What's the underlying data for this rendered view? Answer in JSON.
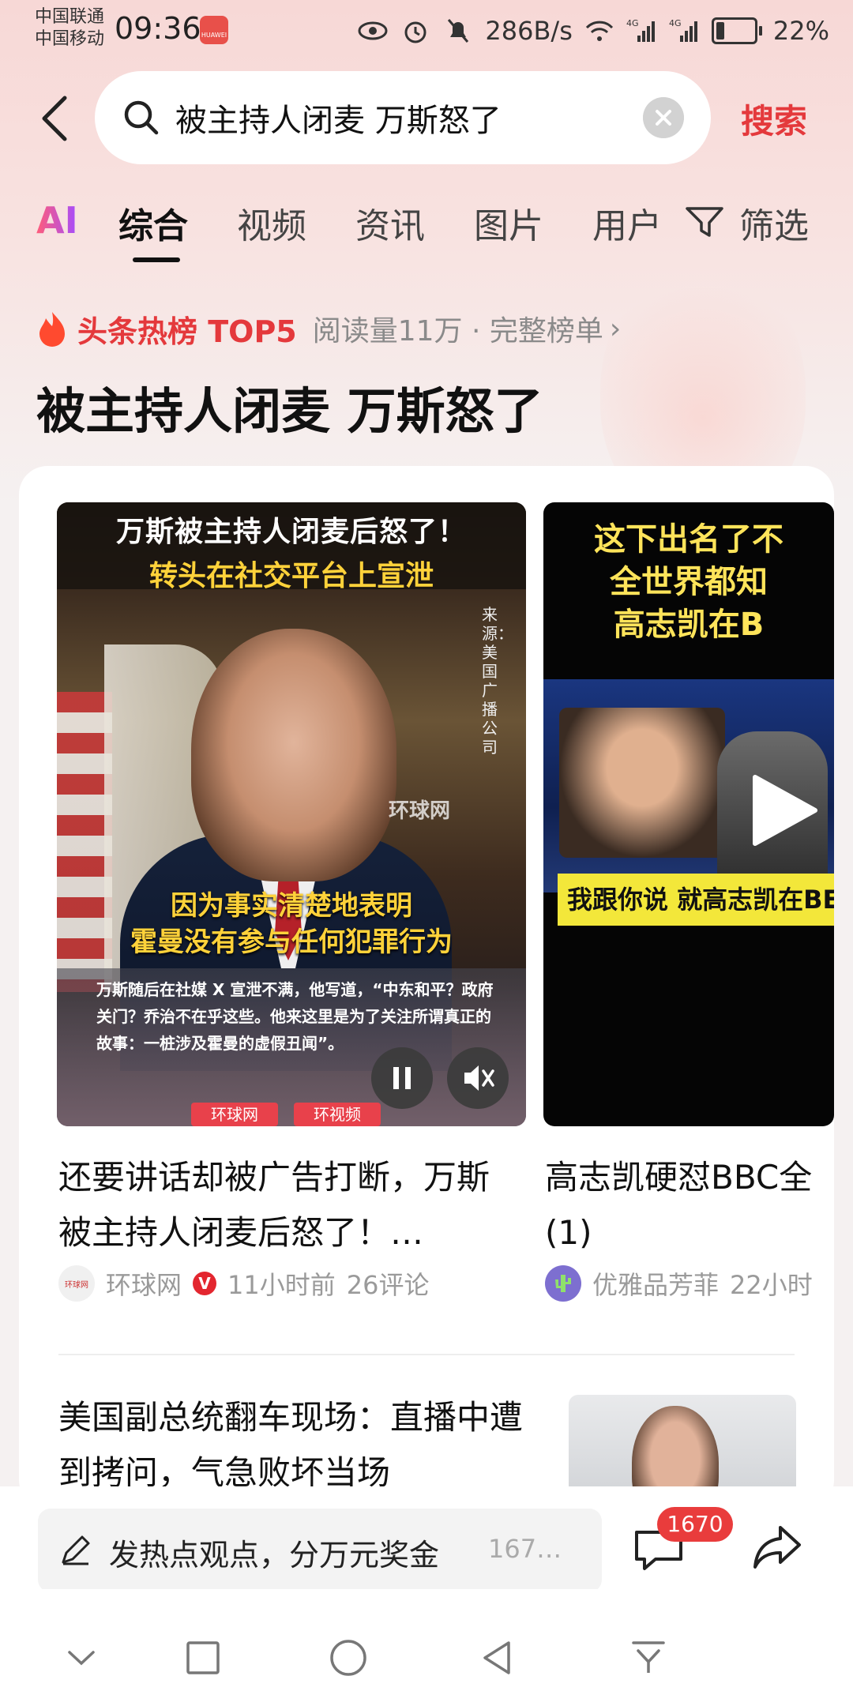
{
  "status_bar": {
    "carrier1": "中国联通",
    "carrier2": "中国移动",
    "time": "09:36",
    "net_speed": "286B/s",
    "signal1_label": "4G",
    "signal2_label": "4G",
    "battery": "22%",
    "battery_level": 0.22,
    "app_badge": "HUAWEI"
  },
  "header": {
    "search_query": "被主持人闭麦 万斯怒了",
    "search_button": "搜索"
  },
  "tabs": [
    {
      "label": "AI"
    },
    {
      "label": "综合",
      "active": true
    },
    {
      "label": "视频"
    },
    {
      "label": "资讯"
    },
    {
      "label": "图片"
    },
    {
      "label": "用户"
    },
    {
      "label": "筛选"
    }
  ],
  "hot_list": {
    "title": "头条热榜 TOP5",
    "meta": "阅读量11万 · 完整榜单",
    "chevron": "›"
  },
  "page_title": "被主持人闭麦 万斯怒了",
  "videos": [
    {
      "thumb_line1": "万斯被主持人闭麦后怒了！",
      "thumb_line2": "转头在社交平台上宣泄",
      "source_vertical": "来源：美国广播公司",
      "watermark": "环球网",
      "caption_line1": "因为事实清楚地表明",
      "caption_line2": "霍曼没有参与任何犯罪行为",
      "footer_text": "万斯随后在社媒 X 宣泄不满，他写道，“中东和平？政府关门？乔治不在乎这些。他来这里是为了关注所谓真正的故事：一桩涉及霍曼的虚假丑闻”。",
      "footer_brand1": "环球网",
      "footer_brand2": "环视频",
      "title": "还要讲话却被广告打断，万斯被主持人闭麦后怒了！…",
      "source": "环球网",
      "time": "11小时前",
      "comments": "26评论"
    },
    {
      "thumb_line1": "这下出名了不",
      "thumb_line2": "全世界都知",
      "thumb_line3": "高志凯在B",
      "subtitle": "我跟你说 就高志凯在BE",
      "title": "高志凯硬怼BBC全",
      "title_line2": "(1)",
      "source": "优雅品芳菲",
      "time": "22小时"
    }
  ],
  "article2": {
    "title": "美国副总统翻车现场：直播中遭到拷问，气急败坏当场"
  },
  "bottom_bar": {
    "comment_placeholder": "发热点观点，分万元奖金",
    "comment_preview": "167…",
    "comment_count": "1670"
  },
  "colors": {
    "accent": "#e4393c",
    "badge": "#e93c3c"
  }
}
